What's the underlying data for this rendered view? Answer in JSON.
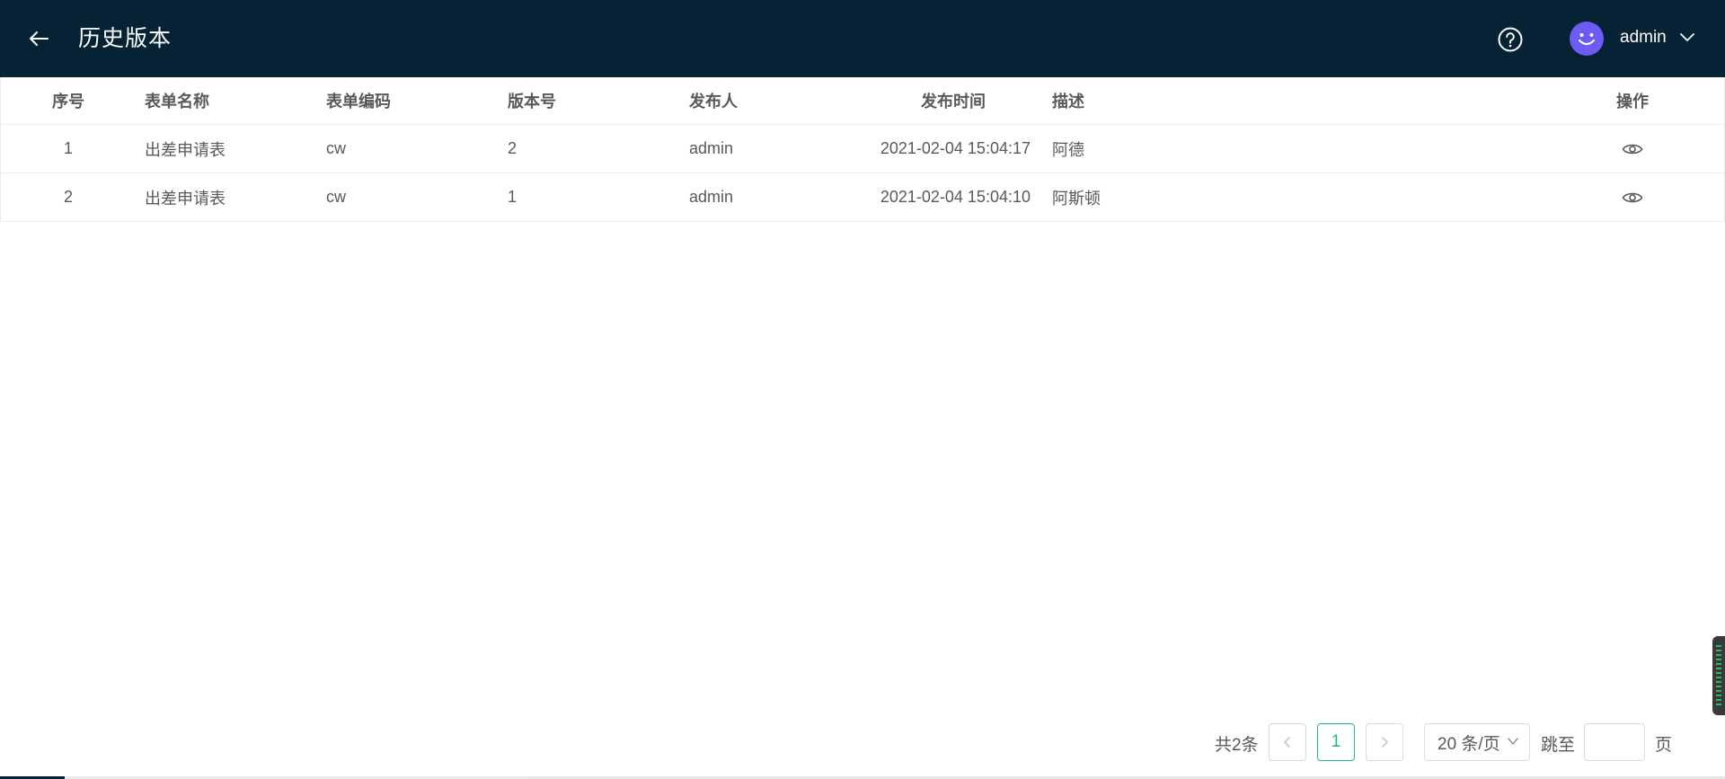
{
  "header": {
    "title": "历史版本",
    "username": "admin",
    "icons": {
      "back": "arrow-left-icon",
      "help": "question-circle-icon",
      "avatar": "smile-avatar-icon",
      "caret": "chevron-down-icon"
    },
    "avatar_color": "#6c5cf3",
    "bar_color": "#062235"
  },
  "table": {
    "columns": {
      "index": "序号",
      "form_name": "表单名称",
      "form_code": "表单编码",
      "version": "版本号",
      "publisher": "发布人",
      "publish_time": "发布时间",
      "description": "描述",
      "actions": "操作"
    },
    "rows": [
      {
        "index": "1",
        "form_name": "出差申请表",
        "form_code": "cw",
        "version": "2",
        "publisher": "admin",
        "publish_time": "2021-02-04 15:04:17",
        "description": "阿德"
      },
      {
        "index": "2",
        "form_name": "出差申请表",
        "form_code": "cw",
        "version": "1",
        "publisher": "admin",
        "publish_time": "2021-02-04 15:04:10",
        "description": "阿斯顿"
      }
    ],
    "action_icon": "eye-icon"
  },
  "pagination": {
    "total": "共2条",
    "current_page": "1",
    "page_size": "20 条/页",
    "goto_label": "跳至",
    "goto_value": "",
    "goto_suffix": "页",
    "accent_color": "#22b38a"
  }
}
